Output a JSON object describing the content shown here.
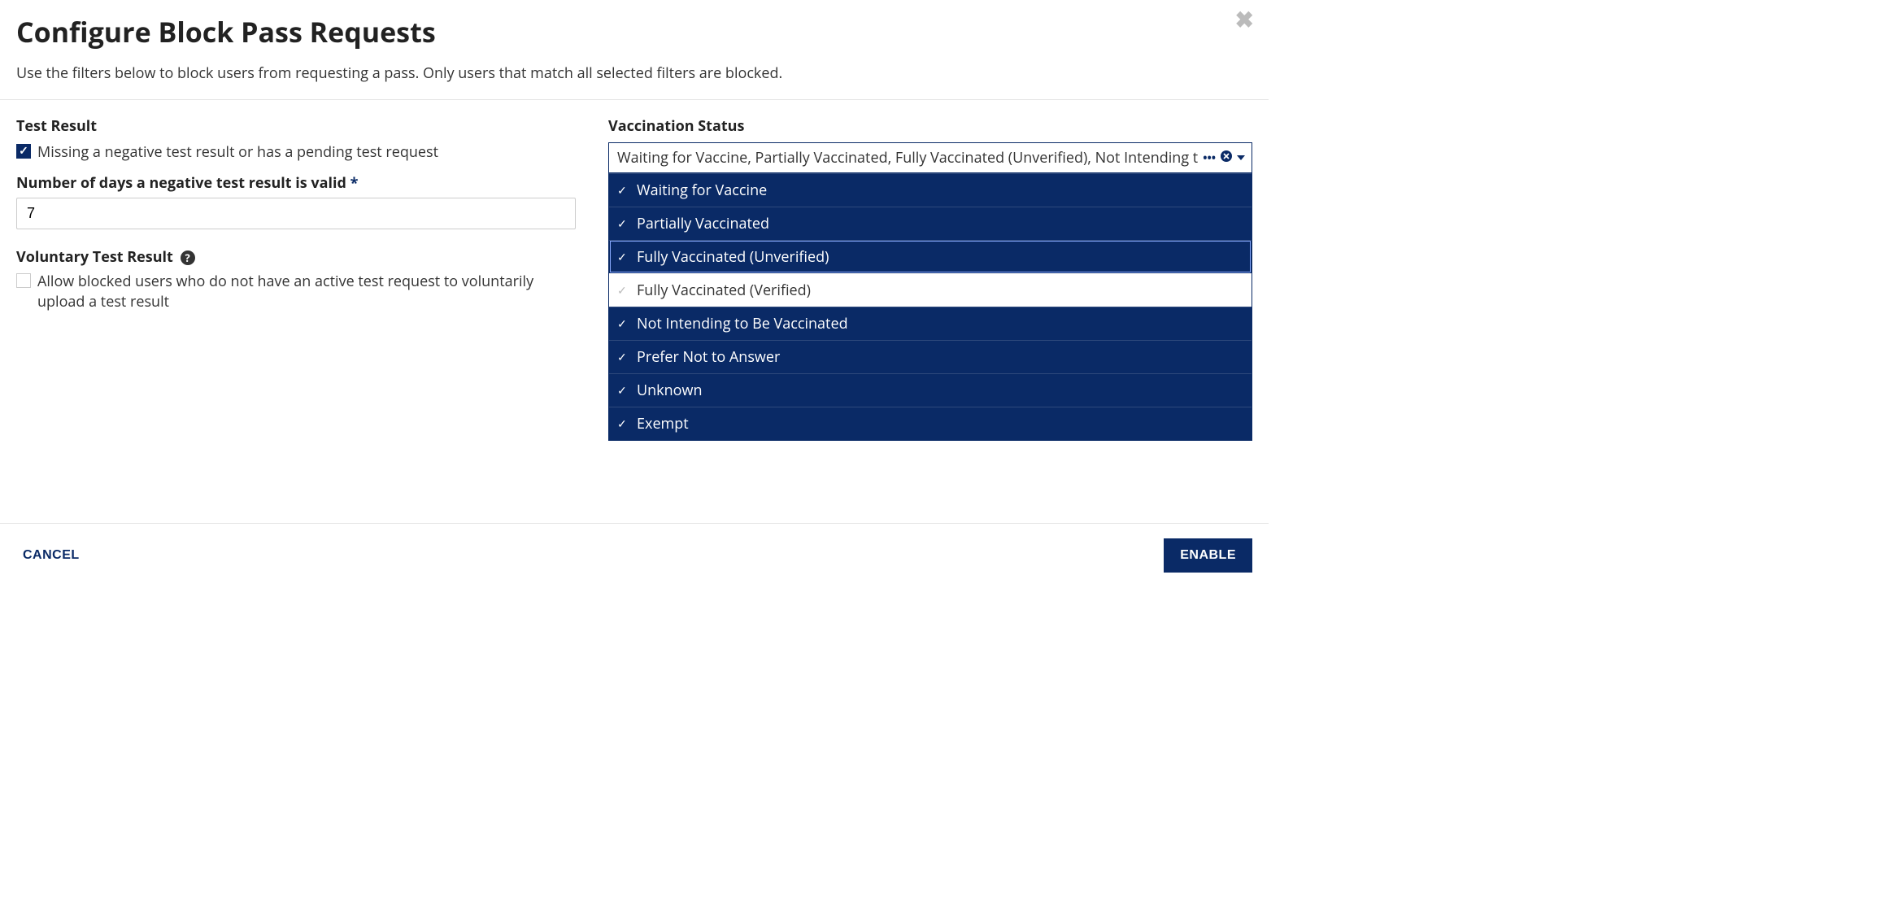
{
  "header": {
    "title": "Configure Block Pass Requests",
    "subtitle": "Use the filters below to block users from requesting a pass. Only users that match all selected filters are blocked."
  },
  "left": {
    "test_result_label": "Test Result",
    "test_result_checkbox_label": "Missing a negative test result or has a pending test request",
    "test_result_checked": true,
    "days_label": "Number of days a negative test result is valid",
    "days_required_marker": "*",
    "days_value": "7",
    "voluntary_label": "Voluntary Test Result",
    "voluntary_checkbox_label": "Allow blocked users who do not have an active test request to voluntarily upload a test result",
    "voluntary_checked": false
  },
  "right": {
    "vaccination_label": "Vaccination Status",
    "selected_display": "Waiting for Vaccine, Partially Vaccinated, Fully Vaccinated (Unverified), Not Intending t",
    "options": [
      {
        "label": "Waiting for Vaccine",
        "selected": true,
        "highlighted": false
      },
      {
        "label": "Partially Vaccinated",
        "selected": true,
        "highlighted": false
      },
      {
        "label": "Fully Vaccinated (Unverified)",
        "selected": true,
        "highlighted": true
      },
      {
        "label": "Fully Vaccinated (Verified)",
        "selected": false,
        "highlighted": false
      },
      {
        "label": "Not Intending to Be Vaccinated",
        "selected": true,
        "highlighted": false
      },
      {
        "label": "Prefer Not to Answer",
        "selected": true,
        "highlighted": false
      },
      {
        "label": "Unknown",
        "selected": true,
        "highlighted": false
      },
      {
        "label": "Exempt",
        "selected": true,
        "highlighted": false
      }
    ]
  },
  "footer": {
    "cancel": "CANCEL",
    "enable": "ENABLE"
  },
  "icons": {
    "ellipsis": "•••"
  }
}
